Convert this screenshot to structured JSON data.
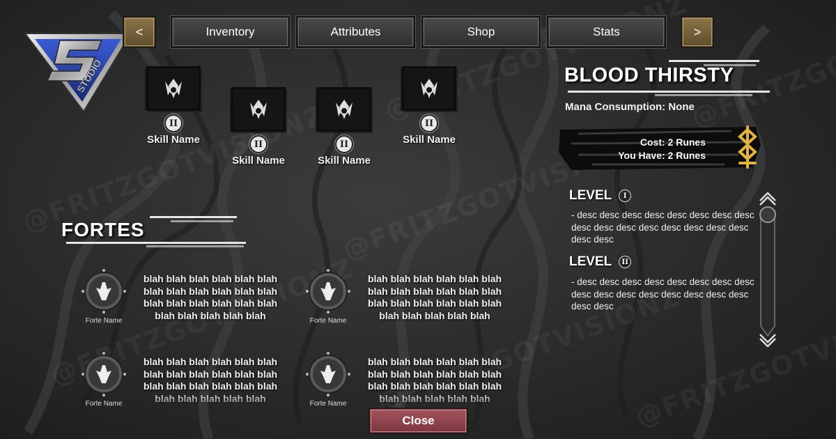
{
  "nav": {
    "prev_label": "<",
    "next_label": ">",
    "tabs": [
      "Inventory",
      "Attributes",
      "Shop",
      "Stats"
    ]
  },
  "skills": [
    {
      "rank": "II",
      "name": "Skill Name"
    },
    {
      "rank": "II",
      "name": "Skill Name"
    },
    {
      "rank": "II",
      "name": "Skill Name"
    },
    {
      "rank": "II",
      "name": "Skill Name"
    }
  ],
  "fortes": {
    "title": "FORTES",
    "items": [
      {
        "name": "Forte Name",
        "desc": "blah blah blah blah blah blah blah blah blah blah blah blah blah blah blah blah blah blah blah blah blah blah blah"
      },
      {
        "name": "Forte Name",
        "desc": "blah blah blah blah blah blah blah blah blah blah blah blah blah blah blah blah blah blah blah blah blah blah blah"
      },
      {
        "name": "Forte Name",
        "desc": "blah blah blah blah blah blah blah blah blah blah blah blah blah blah blah blah blah blah blah blah blah blah blah"
      },
      {
        "name": "Forte Name",
        "desc": "blah blah blah blah blah blah blah blah blah blah blah blah blah blah blah blah blah blah blah blah blah blah blah"
      }
    ]
  },
  "detail": {
    "title": "BLOOD THIRSTY",
    "mana_label": "Mana Consumption:",
    "mana_value": "None",
    "cost": "Cost: 2 Runes",
    "you_have": "You Have: 2 Runes",
    "levels": [
      {
        "label": "LEVEL",
        "rank": "I",
        "desc": "- desc desc desc desc desc desc desc desc desc desc desc desc desc desc desc desc desc desc"
      },
      {
        "label": "LEVEL",
        "rank": "II",
        "desc": "- desc desc desc desc desc desc desc desc desc desc desc desc desc desc desc desc desc desc"
      }
    ],
    "scroll_position": 0.05
  },
  "close_label": "Close",
  "watermark": "@FRITZGOTVISIONZ",
  "logo_letters": "S STUDIO",
  "colors": {
    "accent_gold": "#8a7448",
    "close_red": "#a4545c",
    "background": "#2e2e2e"
  }
}
